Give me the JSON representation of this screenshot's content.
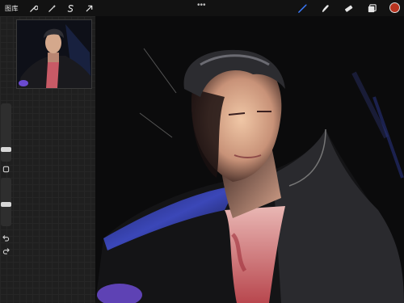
{
  "toolbar": {
    "gallery_label": "图库",
    "more_label": "•••",
    "left_tools": [
      {
        "name": "wrench-icon"
      },
      {
        "name": "magic-wand-icon"
      },
      {
        "name": "selection-s-icon"
      },
      {
        "name": "transform-arrow-icon"
      }
    ],
    "right_tools": [
      {
        "name": "brush-icon",
        "active": true
      },
      {
        "name": "smudge-icon"
      },
      {
        "name": "eraser-icon"
      },
      {
        "name": "layers-icon"
      }
    ],
    "active_color": "#b8331f",
    "accent_color": "#3b7bff"
  },
  "sidebar": {
    "brush_size_level": 0.6,
    "brush_opacity_level": 0.5,
    "modify_button": "square-modify-icon",
    "undo": "undo-icon",
    "redo": "redo-icon"
  },
  "reference": {
    "name": "reference-thumbnail"
  },
  "canvas": {
    "name": "artwork-canvas"
  }
}
